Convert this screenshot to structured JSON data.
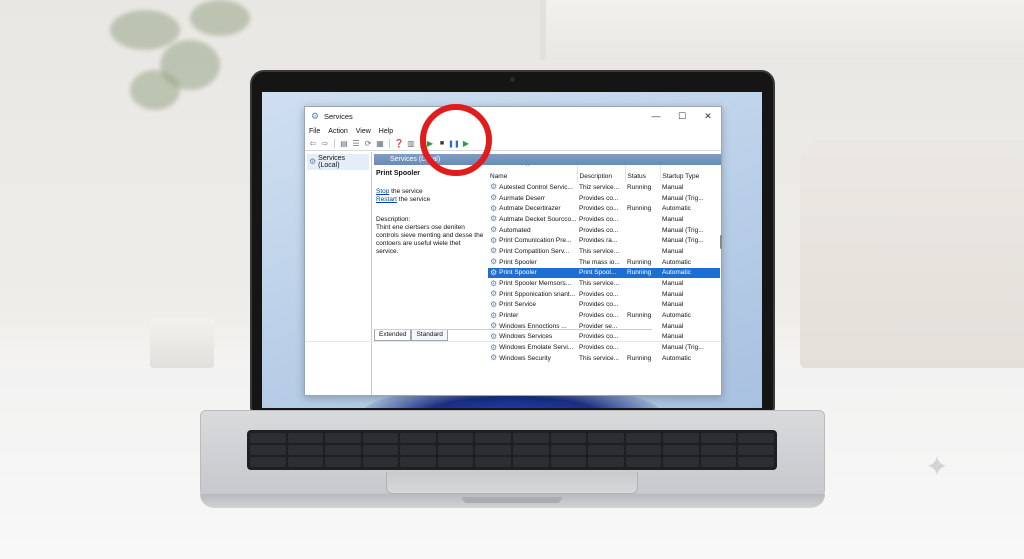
{
  "window": {
    "title": "Services",
    "controls": {
      "minimize": "—",
      "maximize": "☐",
      "close": "✕"
    }
  },
  "menubar": [
    "File",
    "Action",
    "View",
    "Help"
  ],
  "tree": {
    "item": "Services (Local)"
  },
  "pane_header": "Services (Local)",
  "detail": {
    "service_name": "Print Spooler",
    "stop_link": "Stop",
    "stop_rest": " the service",
    "restart_link": "Restart",
    "restart_rest": " the service",
    "description_label": "Description:",
    "description_text": "Thint ene ciertsers ose deniten controls sieve menting and desse the contoers are useful wiele thet service."
  },
  "columns": [
    "Name",
    "Description",
    "Status",
    "Startup Type"
  ],
  "rows": [
    {
      "name": "Autested Control Servic...",
      "desc": "Thiz service...",
      "status": "Running",
      "startup": "Manual"
    },
    {
      "name": "Aurmate Deserr",
      "desc": "Provides co...",
      "status": "",
      "startup": "Manual (Trig..."
    },
    {
      "name": "Autmate Decertirazer",
      "desc": "Provides co...",
      "status": "Running",
      "startup": "Automatic"
    },
    {
      "name": "Autmate Decket Sourcco...",
      "desc": "Provides co...",
      "status": "",
      "startup": "Manual"
    },
    {
      "name": "Automated",
      "desc": "Provides co...",
      "status": "",
      "startup": "Manual (Trig..."
    },
    {
      "name": "Print Comunication Pre...",
      "desc": "Provides ra...",
      "status": "",
      "startup": "Manual (Trig..."
    },
    {
      "name": "Print Compatition Serv...",
      "desc": "This service...",
      "status": "",
      "startup": "Manual"
    },
    {
      "name": "Print Spooler",
      "desc": "The mass io...",
      "status": "Running",
      "startup": "Automatic"
    },
    {
      "name": "Print Spooler",
      "desc": "Print Spool...",
      "status": "Running",
      "startup": "Automatic",
      "selected": true
    },
    {
      "name": "Print Spooler Mernsors...",
      "desc": "This service...",
      "status": "",
      "startup": "Manual"
    },
    {
      "name": "Print Spponication snant...",
      "desc": "Provides co...",
      "status": "",
      "startup": "Manual"
    },
    {
      "name": "Print Service",
      "desc": "Provides co...",
      "status": "",
      "startup": "Manual"
    },
    {
      "name": "Printer",
      "desc": "Provides co...",
      "status": "Running",
      "startup": "Automatic"
    },
    {
      "name": "Windows Ennoctions ...",
      "desc": "Provider se...",
      "status": "",
      "startup": "Manual"
    },
    {
      "name": "Windows Services",
      "desc": "Provides co...",
      "status": "",
      "startup": "Manual"
    },
    {
      "name": "Windows Emolate Servi...",
      "desc": "Provides co...",
      "status": "",
      "startup": "Manual (Trig..."
    },
    {
      "name": "Windows Security",
      "desc": "This service...",
      "status": "Running",
      "startup": "Automatic"
    }
  ],
  "tabs": [
    "Extended",
    "Standard"
  ],
  "colors": {
    "highlight": "#e01c1c",
    "selection": "#1a6fd0",
    "link": "#0645ad"
  },
  "icons": {
    "back": "back-arrow-icon",
    "forward": "forward-arrow-icon",
    "start": "play-icon",
    "stop": "stop-icon",
    "pause": "pause-icon",
    "resume": "resume-icon",
    "service": "gear-icon"
  }
}
